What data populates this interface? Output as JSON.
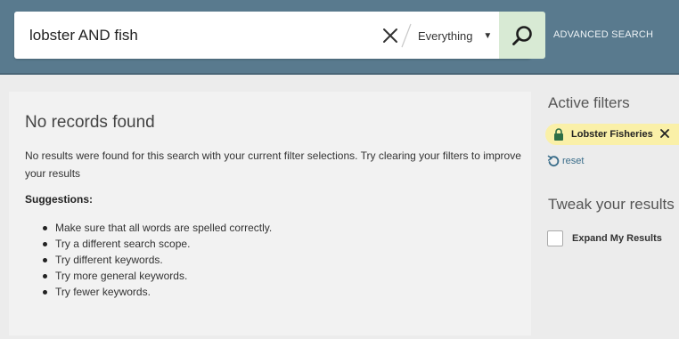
{
  "search": {
    "query": "lobster AND fish",
    "scope": "Everything",
    "advanced_label": "ADVANCED SEARCH"
  },
  "results": {
    "title": "No records found",
    "message": "No results were found for this search with your current filter selections. Try clearing your filters to improve your results",
    "suggestions_heading": "Suggestions:",
    "suggestions": [
      "Make sure that all words are spelled correctly.",
      "Try a different search scope.",
      "Try different keywords.",
      "Try more general keywords.",
      "Try fewer keywords."
    ]
  },
  "sidebar": {
    "active_filters_heading": "Active filters",
    "filter_chip": "Lobster Fisheries",
    "reset_label": "reset",
    "tweak_heading": "Tweak your results",
    "expand_label": "Expand My Results"
  },
  "colors": {
    "header": "#597a8e",
    "search_button": "#d8ead4",
    "filter_chip": "#faf0a8",
    "link": "#3a6d8a"
  }
}
